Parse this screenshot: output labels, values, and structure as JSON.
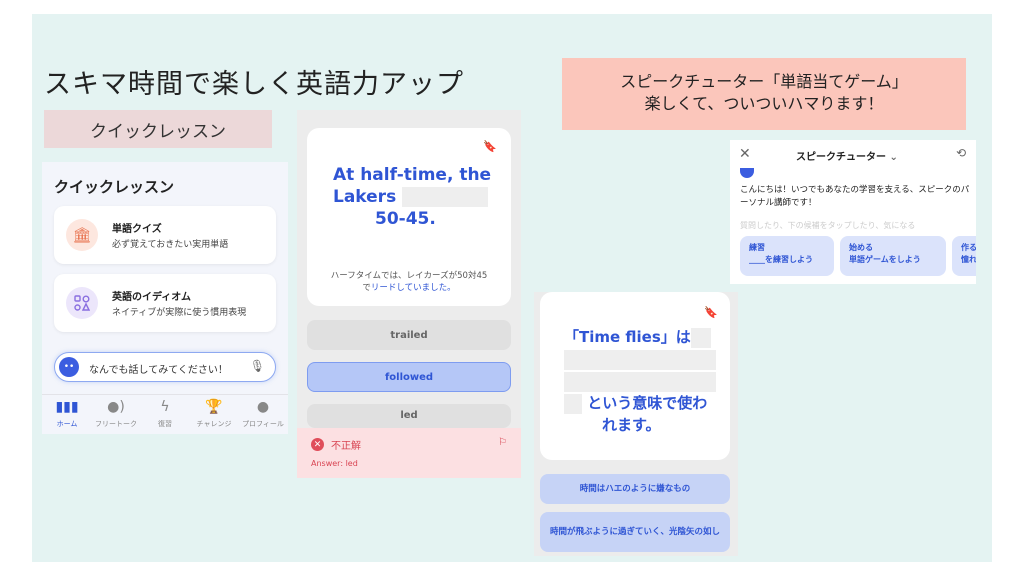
{
  "title": "スキマ時間で楽しく英語力アップ",
  "left_label": "クイックレッスン",
  "right_banner": {
    "line1": "スピークチューター「単語当てゲーム」",
    "line2": "楽しくて、ついついハマります！"
  },
  "phone1": {
    "heading": "クイックレッスン",
    "cards": [
      {
        "title": "単語クイズ",
        "subtitle": "必ず覚えておきたい実用単語",
        "icon": "museum-icon"
      },
      {
        "title": "英語のイディオム",
        "subtitle": "ネイティブが実際に使う慣用表現",
        "icon": "shapes-icon"
      }
    ],
    "chat_placeholder": "なんでも話してみてください！",
    "nav": [
      {
        "label": "ホーム",
        "icon": "waveform-icon"
      },
      {
        "label": "フリートーク",
        "icon": "person-speaking-icon"
      },
      {
        "label": "復習",
        "icon": "lightning-icon"
      },
      {
        "label": "チャレンジ",
        "icon": "trophy-icon"
      },
      {
        "label": "プロフィール",
        "icon": "person-icon"
      }
    ]
  },
  "phone2": {
    "question_line1": "At half-time, the",
    "question_word": "Lakers",
    "question_score": "50-45.",
    "translation_part1": "ハーフタイムでは、レイカーズが50対45",
    "translation_part2a": "で",
    "translation_part2b": "リードしていました。",
    "options": [
      "trailed",
      "followed",
      "led"
    ],
    "result_label": "不正解",
    "answer": "Answer: led"
  },
  "phone3": {
    "phrase_start": "「Time flies」は",
    "phrase_end1": "という意味で使わ",
    "phrase_end2": "れます。",
    "options": [
      "時間はハエのように嫌なもの",
      "時間が飛ぶように過ぎていく、光陰矢の如し"
    ]
  },
  "panel4": {
    "title": "スピークチューター",
    "message": "こんにちは！いつでもあなたの学習を支える、スピークのパーソナル講師です！",
    "faded": "質問したり、下の候補をタップしたり、気になる",
    "chips": [
      {
        "line1": "練習",
        "line2": "____を練習しよう"
      },
      {
        "line1": "始める",
        "line2": "単語ゲームをしよう"
      },
      {
        "line1": "作る",
        "line2": "憧れ"
      }
    ]
  },
  "colors": {
    "background": "#e4f3f2",
    "accent": "#2f55d4",
    "banner": "#fbc6bb",
    "label_bg": "#ecd8d9",
    "error": "#d84452"
  }
}
